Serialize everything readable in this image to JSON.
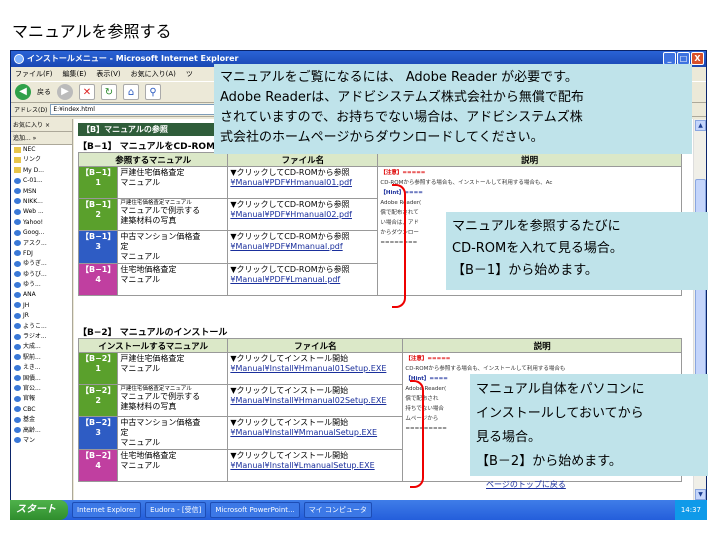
{
  "slide_title": "マニュアルを参照する",
  "window": {
    "title": "インストールメニュー - Microsoft Internet Explorer",
    "min_label": "_",
    "max_label": "□",
    "close_label": "X"
  },
  "menubar": [
    "ファイル(F)",
    "編集(E)",
    "表示(V)",
    "お気に入り(A)",
    "ツ"
  ],
  "toolbar": {
    "back": "戻る",
    "forward": ""
  },
  "address": {
    "label": "アドレス(D)",
    "value": "E:¥index.html"
  },
  "sidebar": {
    "header": "お気に入り",
    "close": "×",
    "add": "追加...",
    "more": "»",
    "items": [
      "NEC",
      "リンク",
      "My D...",
      "C-01...",
      "MSN",
      "NIKK...",
      "Web ...",
      "Yahoo!",
      "Goog...",
      "アスク...",
      "FDJ",
      "ゆうぎ...",
      "ゆうび...",
      "ゆう...",
      "ANA",
      "JH",
      "JR",
      "ようこ...",
      "ラジオ...",
      "大成...",
      "駅前...",
      "えき...",
      "国債...",
      "官公...",
      "官報",
      "CBC",
      "基金",
      "高齢...",
      "マン"
    ]
  },
  "section1": {
    "bar": "【B】マニュアルの参照",
    "heading": "【B−1】 マニュアルをCD-ROMから参照",
    "headers": [
      "参照するマニュアル",
      "ファイル名",
      "説明"
    ],
    "rows": [
      {
        "code": "【B−1】\n1",
        "color": "#5aa02c",
        "name_small": "",
        "name": "戸建住宅価格査定\nマニュアル",
        "link_text": "▼クリックしてCD-ROMから参照",
        "file": "¥Manual¥PDF¥Hmanual01.pdf"
      },
      {
        "code": "【B−1】\n2",
        "color": "#5aa02c",
        "name_small": "戸建住宅価格査定マニュアル",
        "name": "マニュアルで例示する\n建築材料の写真",
        "link_text": "▼クリックしてCD-ROMから参照",
        "file": "¥Manual¥PDF¥Hmanual02.pdf"
      },
      {
        "code": "【B−1】\n3",
        "color": "#2e5cc4",
        "name_small": "",
        "name": "中古マンション価格査\n定\nマニュアル",
        "link_text": "▼クリックしてCD-ROMから参照",
        "file": "¥Manual¥PDF¥Mmanual.pdf"
      },
      {
        "code": "【B−1】\n4",
        "color": "#c03fa0",
        "name_small": "",
        "name": "住宅地価格査定\nマニュアル",
        "link_text": "▼クリックしてCD-ROMから参照",
        "file": "¥Manual¥PDF¥Lmanual.pdf"
      }
    ],
    "note": {
      "head": "【注意】=====",
      "body": "CD-ROMから参照する場合も、インストールして利用する場合も、Ac",
      "hint": "【Hint】====",
      "hint_body": "Adobe Reader(\n償で配布されて\nい場合は、アド\nからダウンロー\n========"
    }
  },
  "section2": {
    "heading": "【B−2】 マニュアルのインストール",
    "headers": [
      "インストールするマニュアル",
      "ファイル名",
      "説明"
    ],
    "rows": [
      {
        "code": "【B−2】\n1",
        "color": "#5aa02c",
        "name_small": "",
        "name": "戸建住宅価格査定\nマニュアル",
        "link_text": "▼クリックしてインストール開始",
        "file": "¥Manual¥Install¥Hmanual01Setup.EXE"
      },
      {
        "code": "【B−2】\n2",
        "color": "#5aa02c",
        "name_small": "戸建住宅価格査定マニュアル",
        "name": "マニュアルで例示する\n建築材料の写真",
        "link_text": "▼クリックしてインストール開始",
        "file": "¥Manual¥Install¥Hmanual02Setup.EXE"
      },
      {
        "code": "【B−2】\n3",
        "color": "#2e5cc4",
        "name_small": "",
        "name": "中古マンション価格査\n定\nマニュアル",
        "link_text": "▼クリックしてインストール開始",
        "file": "¥Manual¥Install¥MmanualSetup.EXE"
      },
      {
        "code": "【B−2】\n4",
        "color": "#c03fa0",
        "name_small": "",
        "name": "住宅地価格査定\nマニュアル",
        "link_text": "▼クリックしてインストール開始",
        "file": "¥Manual¥Install¥LmanualSetup.EXE"
      }
    ],
    "note": {
      "head": "【注意】=====",
      "body": "CD-ROMから参照する場合も、インストールして利用する場合も",
      "hint": "【Hint】====",
      "hint_body": "Adobe Reader(\n償で配布され\n持ちでない場合\nムページから\n========="
    }
  },
  "top_link": "ページのトップに戻る",
  "callouts": {
    "top": "マニュアルをご覧になるには、 Adobe Reader が必要です。\nAdobe Readerは、アドビシステムズ株式会社から無償で配布\nされていますので、お持ちでない場合は、アドビシステムズ株\n式会社のホームページからダウンロードしてください。",
    "mid": "マニュアルを参照するたびに\nCD-ROMを入れて見る場合。\n【B－1】から始めます。",
    "bottom": "マニュアル自体をパソコンに\nインストールしておいてから\n見る場合。\n【B－2】から始めます。"
  },
  "taskbar": {
    "start": "スタート",
    "buttons": [
      "Internet Explorer",
      "Eudora - [受信]",
      "Microsoft PowerPoint...",
      "マイ コンピュータ"
    ],
    "clock": "14:37"
  }
}
